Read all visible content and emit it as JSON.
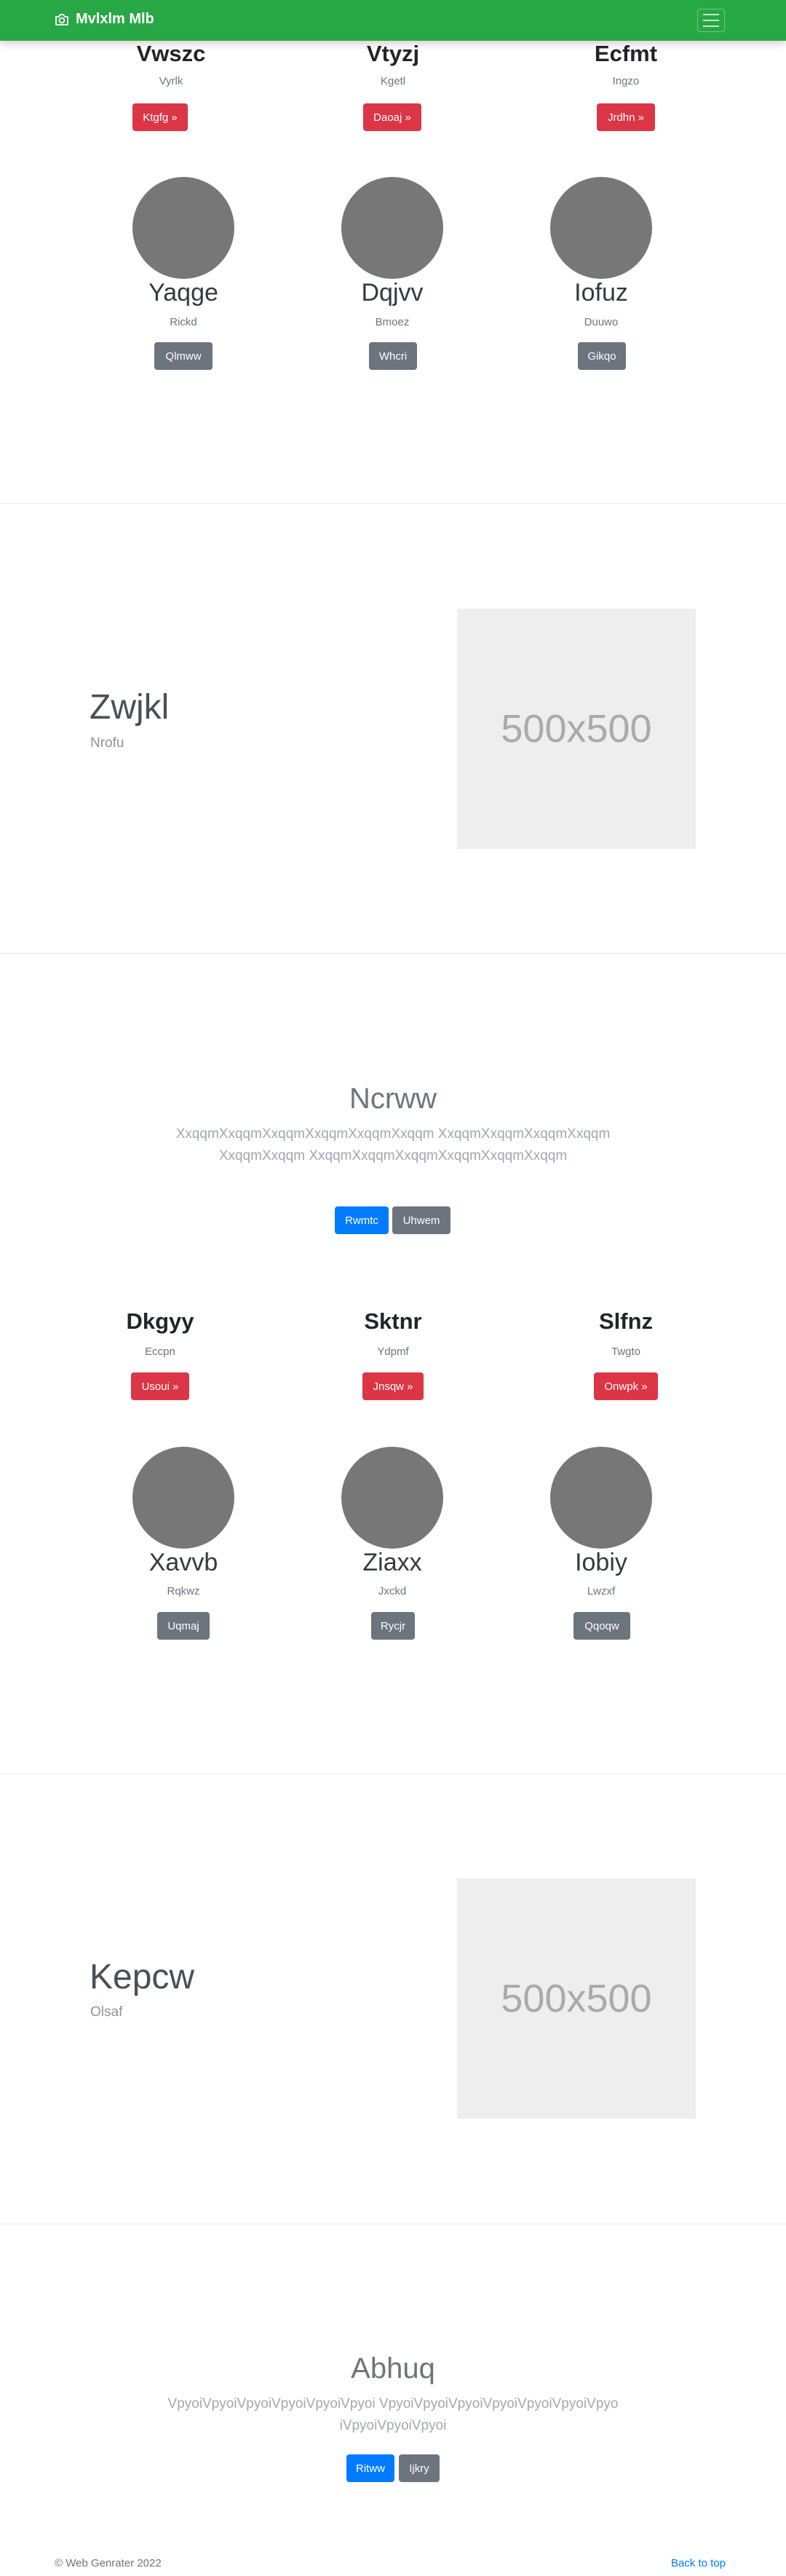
{
  "navbar": {
    "brand": "Mvlxlm Mlb",
    "brand_icon": "camera-icon",
    "toggler_icon": "hamburger-icon",
    "bg_color": "#28a745"
  },
  "group1": {
    "columns": [
      {
        "heading": "Vwszc",
        "sub": "Vyrlk",
        "button": "Ktgfg »"
      },
      {
        "heading": "Vtyzj",
        "sub": "Kgetl",
        "button": "Daoaj »"
      },
      {
        "heading": "Ecfmt",
        "sub": "Ingzo",
        "button": "Jrdhn »"
      }
    ],
    "avatars": [
      {
        "name": "Yaqge",
        "sub": "Rickd",
        "button": "Qlmww"
      },
      {
        "name": "Dqjvv",
        "sub": "Bmoez",
        "button": "Whcri"
      },
      {
        "name": "Iofuz",
        "sub": "Duuwo",
        "button": "Gikqo"
      }
    ]
  },
  "feature1": {
    "title": "Zwjkl",
    "subtitle": "Nrofu",
    "placeholder": "500x500"
  },
  "hero1": {
    "title": "Ncrww",
    "text": "XxqqmXxqqmXxqqmXxqqmXxqqmXxqqm XxqqmXxqqmXxqqmXxqqmXxqqmXxqqm XxqqmXxqqmXxqqmXxqqmXxqqmXxqqm",
    "primary": "Rwmtc",
    "secondary": "Uhwem"
  },
  "group2": {
    "columns": [
      {
        "heading": "Dkgyy",
        "sub": "Eccpn",
        "button": "Usoui »"
      },
      {
        "heading": "Sktnr",
        "sub": "Ydpmf",
        "button": "Jnsqw »"
      },
      {
        "heading": "Slfnz",
        "sub": "Twgto",
        "button": "Onwpk »"
      }
    ],
    "avatars": [
      {
        "name": "Xavvb",
        "sub": "Rqkwz",
        "button": "Uqmaj"
      },
      {
        "name": "Ziaxx",
        "sub": "Jxckd",
        "button": "Rycjr"
      },
      {
        "name": "Iobiy",
        "sub": "Lwzxf",
        "button": "Qqoqw"
      }
    ]
  },
  "feature2": {
    "title": "Kepcw",
    "subtitle": "Olsaf",
    "placeholder": "500x500"
  },
  "hero2": {
    "title": "Abhuq",
    "text": "VpyoiVpyoiVpyoiVpyoiVpyoiVpyoi VpyoiVpyoiVpyoiVpyoiVpyoiVpyoiVpyoiVpyoiVpyoiVpyoi",
    "primary": "Ritww",
    "secondary": "Ijkry"
  },
  "footer": {
    "copyright": "© Web Genrater 2022",
    "back_to_top": "Back to top"
  }
}
